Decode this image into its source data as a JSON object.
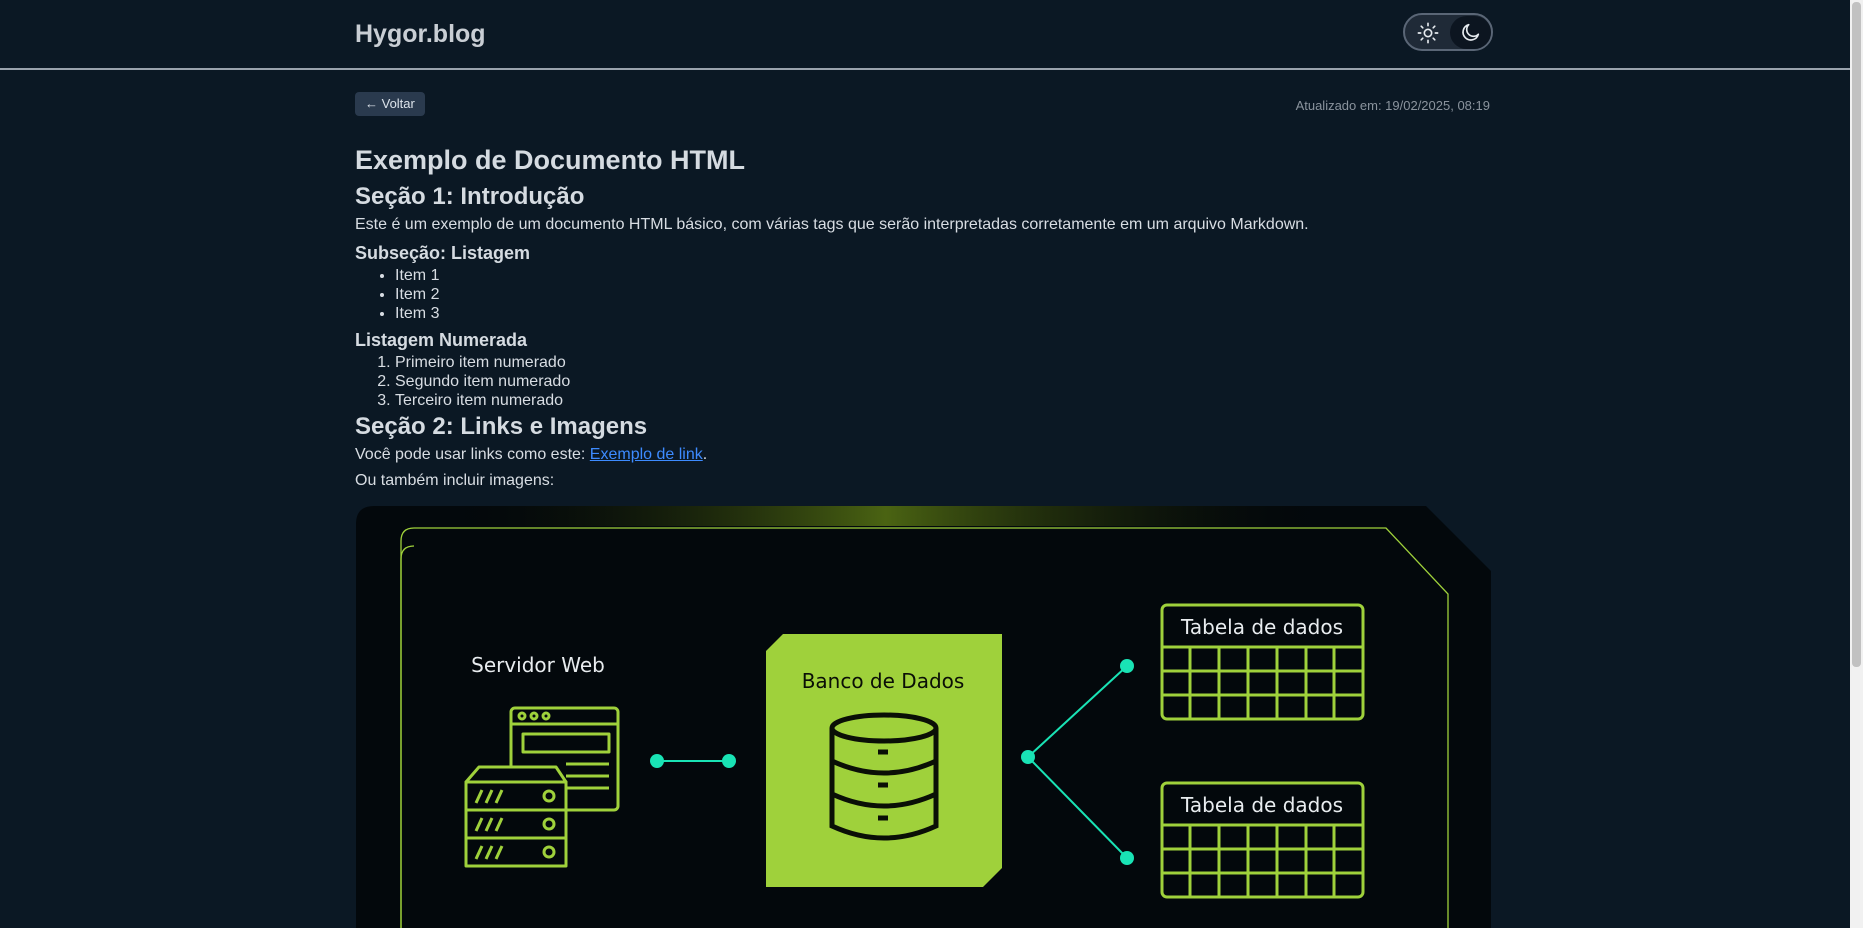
{
  "header": {
    "site_title": "Hygor.blog",
    "theme": {
      "light_icon": "sun-icon",
      "dark_icon": "moon-icon",
      "active": "dark"
    }
  },
  "toolbar": {
    "back_label": "← Voltar",
    "updated_text": "Atualizado em: 19/02/2025, 08:19"
  },
  "article": {
    "title": "Exemplo de Documento HTML",
    "section1": {
      "heading": "Seção 1: Introdução",
      "paragraph": "Este é um exemplo de um documento HTML básico, com várias tags que serão interpretadas corretamente em um arquivo Markdown.",
      "subheading": "Subseção: Listagem",
      "items": [
        "Item 1",
        "Item 2",
        "Item 3"
      ],
      "numbered_heading": "Listagem Numerada",
      "numbered_items": [
        "Primeiro item numerado",
        "Segundo item numerado",
        "Terceiro item numerado"
      ]
    },
    "section2": {
      "heading": "Seção 2: Links e Imagens",
      "link_prefix": "Você pode usar links como este: ",
      "link_text": "Exemplo de link",
      "link_suffix": ".",
      "images_text": "Ou também incluir imagens:"
    },
    "diagram": {
      "server_label": "Servidor Web",
      "database_label": "Banco de Dados",
      "table1_label": "Tabela de dados",
      "table2_label": "Tabela de dados",
      "accent": "#9fd13b",
      "connector": "#19e3b5"
    }
  }
}
